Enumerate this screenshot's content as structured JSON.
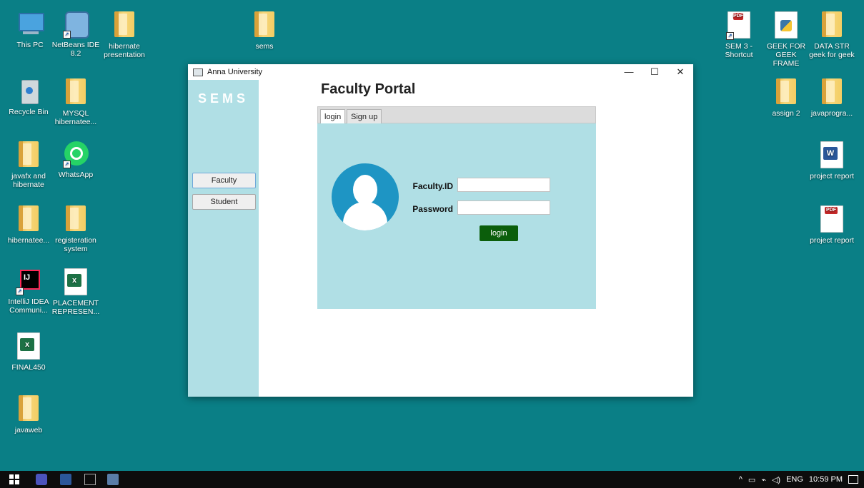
{
  "desktop": {
    "icons_left": [
      {
        "label": "This PC",
        "icon": "this-pc-icon"
      },
      {
        "label": "NetBeans IDE 8.2",
        "icon": "netbeans-icon"
      },
      {
        "label": "hibernate presentation",
        "icon": "document-icon"
      },
      {
        "label": "Recycle Bin",
        "icon": "recycle-bin-icon"
      },
      {
        "label": "MYSQL hibernatee...",
        "icon": "folder-icon"
      },
      {
        "label": "javafx and hibernate",
        "icon": "folder-icon"
      },
      {
        "label": "WhatsApp",
        "icon": "whatsapp-icon"
      },
      {
        "label": "hibernatee...",
        "icon": "folder-icon"
      },
      {
        "label": "registeration system",
        "icon": "folder-icon"
      },
      {
        "label": "IntelliJ IDEA Communi...",
        "icon": "intellij-icon"
      },
      {
        "label": "PLACEMENT REPRESEN...",
        "icon": "excel-icon"
      },
      {
        "label": "FINAL450",
        "icon": "excel-icon"
      },
      {
        "label": "javaweb",
        "icon": "folder-icon"
      },
      {
        "label": "sems",
        "icon": "folder-icon"
      }
    ],
    "icons_right": [
      {
        "label": "SEM 3 - Shortcut",
        "icon": "pdf-icon"
      },
      {
        "label": "GEEK FOR GEEK FRAME",
        "icon": "python-file-icon"
      },
      {
        "label": "DATA STR geek for geek",
        "icon": "folder-icon"
      },
      {
        "label": "assign 2",
        "icon": "document-icon"
      },
      {
        "label": "javaprogra...",
        "icon": "folder-icon"
      },
      {
        "label": "project report",
        "icon": "word-icon"
      },
      {
        "label": "project report",
        "icon": "pdf-icon"
      }
    ]
  },
  "window": {
    "title": "Anna University",
    "controls": {
      "minimize": "—",
      "maximize": "☐",
      "close": "✕"
    },
    "sidebar": {
      "brand": "SEMS",
      "buttons": [
        "Faculty",
        "Student"
      ]
    },
    "main": {
      "heading": "Faculty Portal",
      "tabs": [
        "login",
        "Sign up"
      ],
      "form": {
        "id_label": "Faculty.ID",
        "id_value": "",
        "password_label": "Password",
        "password_value": "",
        "submit": "login"
      }
    }
  },
  "taskbar": {
    "tray": {
      "language": "ENG",
      "time": "10:59 PM"
    }
  },
  "colors": {
    "desktop": "#0a7f86",
    "panel": "#b0dfe5",
    "login_button": "#0b5e0b",
    "avatar": "#1e95c4"
  }
}
